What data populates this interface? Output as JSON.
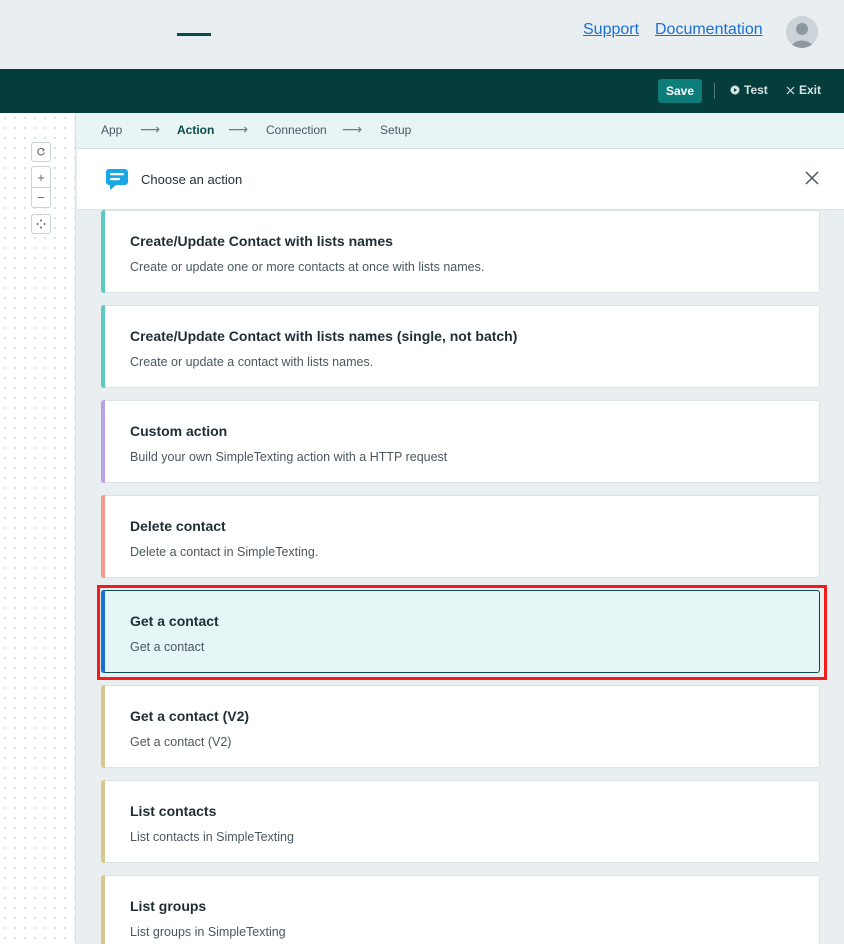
{
  "topbar": {
    "support_label": "Support",
    "docs_label": "Documentation",
    "avatar_icon": "user-avatar-icon"
  },
  "header": {
    "save_label": "Save",
    "test_label": "Test",
    "exit_label": "Exit"
  },
  "canvas_controls": [
    "reset-icon",
    "zoom-in-icon",
    "zoom-out-icon",
    "fit-view-icon"
  ],
  "steps": [
    {
      "label": "App",
      "active": false
    },
    {
      "label": "Action",
      "active": true
    },
    {
      "label": "Connection",
      "active": false
    },
    {
      "label": "Setup",
      "active": false
    }
  ],
  "panel": {
    "title": "Choose an action",
    "app_icon": "simpletexting-logo-icon"
  },
  "actions": [
    {
      "title": "Create/Update Contact with lists names",
      "description": "Create or update one or more contacts at once with lists names.",
      "accent": "#5ec9c0",
      "selected": false
    },
    {
      "title": "Create/Update Contact with lists names (single, not batch)",
      "description": "Create or update a contact with lists names.",
      "accent": "#5ec9c0",
      "selected": false
    },
    {
      "title": "Custom action",
      "description": "Build your own SimpleTexting action with a HTTP request",
      "accent": "#b8a3e6",
      "selected": false
    },
    {
      "title": "Delete contact",
      "description": "Delete a contact in SimpleTexting.",
      "accent": "#f39a8a",
      "selected": false
    },
    {
      "title": "Get a contact",
      "description": "Get a contact",
      "accent": "#1a6fd6",
      "selected": true
    },
    {
      "title": "Get a contact (V2)",
      "description": "Get a contact (V2)",
      "accent": "#d8c98a",
      "selected": false
    },
    {
      "title": "List contacts",
      "description": "List contacts in SimpleTexting",
      "accent": "#d8c98a",
      "selected": false
    },
    {
      "title": "List groups",
      "description": "List groups in SimpleTexting",
      "accent": "#d8c98a",
      "selected": false
    }
  ],
  "colors": {
    "dark_header": "#053c3c",
    "save_button": "#0e7c78",
    "highlight": "#f21c1c"
  }
}
